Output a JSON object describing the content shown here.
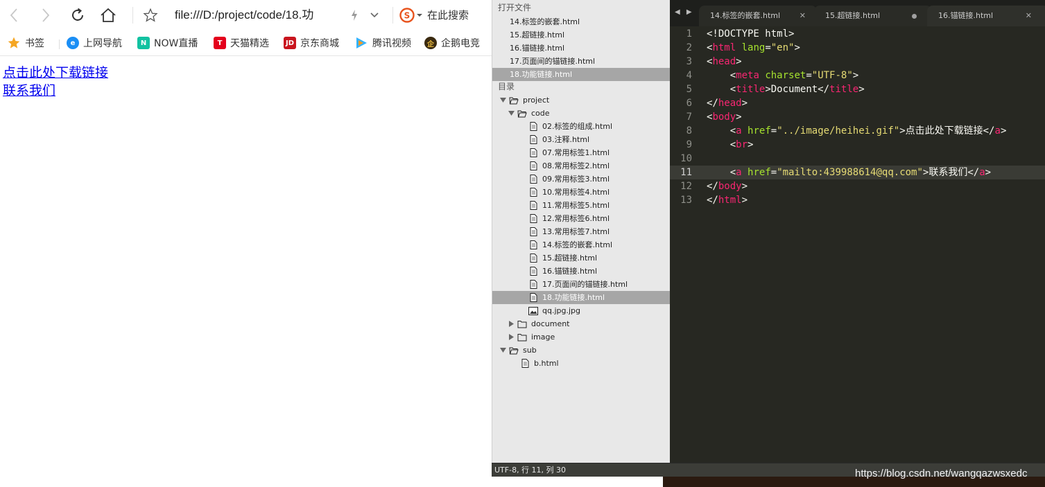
{
  "browser": {
    "url": "file:///D:/project/code/18.功",
    "search_placeholder": "在此搜索",
    "bookmarks": [
      {
        "label": "书签",
        "icon": "star-icon",
        "color": "#f5a623"
      },
      {
        "label": "上网导航",
        "icon": "ie-icon",
        "color": "#1a8ef5"
      },
      {
        "label": "NOW直播",
        "icon": "now-icon",
        "color": "#12c2a1"
      },
      {
        "label": "天猫精选",
        "icon": "tmall-icon",
        "color": "#e4001c"
      },
      {
        "label": "京东商城",
        "icon": "jd-icon",
        "color": "#c9151e"
      },
      {
        "label": "腾讯视频",
        "icon": "tencent-video-icon",
        "color": "#35b3ff"
      },
      {
        "label": "企鹅电竞",
        "icon": "penguin-esports-icon",
        "color": "#c08a1c"
      }
    ],
    "links": [
      "点击此处下载链接",
      "联系我们"
    ]
  },
  "sidebar": {
    "open_files_header": "打开文件",
    "open_files": [
      "14.标签的嵌套.html",
      "15.超链接.html",
      "16.锚链接.html",
      "17.页面间的锚链接.html",
      "18.功能链接.html"
    ],
    "folders_header": "目录",
    "tree": [
      {
        "name": "project",
        "type": "folder-open",
        "level": 0,
        "expanded": true
      },
      {
        "name": "code",
        "type": "folder-open",
        "level": 1,
        "expanded": true
      },
      {
        "name": "02.标签的组成.html",
        "type": "file",
        "level": 2
      },
      {
        "name": "03.注释.html",
        "type": "file",
        "level": 2
      },
      {
        "name": "07.常用标签1.html",
        "type": "file",
        "level": 2
      },
      {
        "name": "08.常用标签2.html",
        "type": "file",
        "level": 2
      },
      {
        "name": "09.常用标签3.html",
        "type": "file",
        "level": 2
      },
      {
        "name": "10.常用标签4.html",
        "type": "file",
        "level": 2
      },
      {
        "name": "11.常用标签5.html",
        "type": "file",
        "level": 2
      },
      {
        "name": "12.常用标签6.html",
        "type": "file",
        "level": 2
      },
      {
        "name": "13.常用标签7.html",
        "type": "file",
        "level": 2
      },
      {
        "name": "14.标签的嵌套.html",
        "type": "file",
        "level": 2
      },
      {
        "name": "15.超链接.html",
        "type": "file",
        "level": 2
      },
      {
        "name": "16.锚链接.html",
        "type": "file",
        "level": 2
      },
      {
        "name": "17.页面间的锚链接.html",
        "type": "file",
        "level": 2
      },
      {
        "name": "18.功能链接.html",
        "type": "file",
        "level": 2,
        "active": true
      },
      {
        "name": "qq.jpg.jpg",
        "type": "image",
        "level": 2
      },
      {
        "name": "document",
        "type": "folder",
        "level": 1,
        "expanded": false
      },
      {
        "name": "image",
        "type": "folder",
        "level": 1,
        "expanded": false
      },
      {
        "name": "sub",
        "type": "folder-open",
        "level": 0,
        "expanded": true
      },
      {
        "name": "b.html",
        "type": "file",
        "level": 1
      }
    ]
  },
  "editor": {
    "tabs": [
      {
        "label": "14.标签的嵌套.html",
        "state": "close"
      },
      {
        "label": "15.超链接.html",
        "state": "dirty"
      },
      {
        "label": "16.锚链接.html",
        "state": "close"
      }
    ],
    "current_line": 11,
    "lines": [
      {
        "n": "1",
        "html": "&lt;!DOCTYPE html&gt;"
      },
      {
        "n": "2",
        "html": "<span class='pl'>&lt;</span><span class='tg'>html</span> <span class='at'>lang</span>=<span class='st'>\"en\"</span>&gt;"
      },
      {
        "n": "3",
        "html": "&lt;<span class='tg'>head</span>&gt;"
      },
      {
        "n": "4",
        "html": "    &lt;<span class='tg'>meta</span> <span class='at'>charset</span>=<span class='st'>\"UTF-8\"</span>&gt;"
      },
      {
        "n": "5",
        "html": "    &lt;<span class='tg'>title</span>&gt;Document&lt;/<span class='tg'>title</span>&gt;"
      },
      {
        "n": "6",
        "html": "&lt;/<span class='tg'>head</span>&gt;"
      },
      {
        "n": "7",
        "html": "&lt;<span class='tg'>body</span>&gt;"
      },
      {
        "n": "8",
        "html": "    &lt;<span class='tg'>a</span> <span class='at'>href</span>=<span class='st'>\"../image/heihei.gif\"</span>&gt;点击此处下载链接&lt;/<span class='tg'>a</span>&gt;"
      },
      {
        "n": "9",
        "html": "    &lt;<span class='tg'>br</span>&gt;"
      },
      {
        "n": "10",
        "html": ""
      },
      {
        "n": "11",
        "html": "    &lt;<span class='tg'>a</span> <span class='at'>href</span>=<span class='st'>\"mailto:439988614@qq.com\"</span>&gt;联系我们&lt;/<span class='tg'>a</span>&gt;"
      },
      {
        "n": "12",
        "html": "&lt;/<span class='tg'>body</span>&gt;"
      },
      {
        "n": "13",
        "html": "&lt;/<span class='tg'>html</span>&gt;"
      }
    ]
  },
  "statusbar": {
    "text": "UTF-8, 行 11, 列 30"
  },
  "watermark": "https://blog.csdn.net/wangqazwsxedc",
  "colors": {
    "editor_bg": "#272822",
    "tag": "#f92672",
    "attr": "#a6e22e",
    "string": "#e6db74",
    "sidebar_active": "#a6a6a6"
  }
}
